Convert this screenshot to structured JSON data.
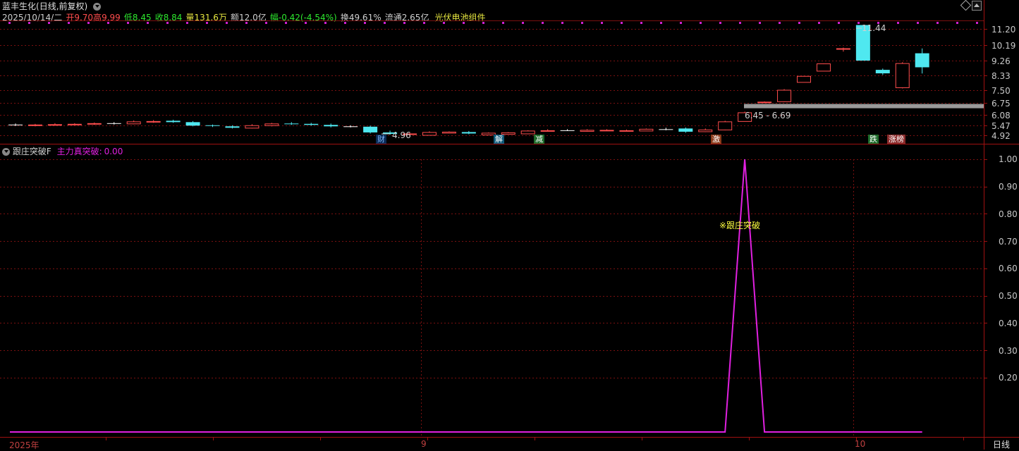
{
  "title_bar": {
    "stock_name": "蓝丰生化",
    "period": "(日线,前复权)",
    "menu_icon": "chevron-down-icon",
    "window_controls": [
      "pin-icon",
      "scroll-up-icon"
    ]
  },
  "quote": {
    "date": "2025/10/14/二",
    "open_label": "开",
    "open": "9.70",
    "high_label": "高",
    "high": "9.99",
    "low_label": "低",
    "low": "8.45",
    "close_label": "收",
    "close": "8.84",
    "volume_label": "量",
    "volume": "131.6万",
    "amount_label": "额",
    "amount": "12.0亿",
    "change_label": "幅",
    "change": "-0.42(-4.54%)",
    "turnover_label": "换",
    "turnover": "49.61%",
    "float_label": "流通",
    "float": "2.65亿",
    "sector": "光伏电池组件"
  },
  "price_axis": [
    "11.20",
    "10.19",
    "9.26",
    "8.33",
    "7.50",
    "6.75",
    "6.08",
    "5.47",
    "4.92"
  ],
  "indicator_axis": [
    "1.00",
    "0.90",
    "0.80",
    "0.70",
    "0.60",
    "0.50",
    "0.40",
    "0.30",
    "0.20"
  ],
  "annotations": {
    "high_label": "11.44",
    "low_label": "4.96",
    "range_label": "6.45 - 6.69",
    "signal_text": "※跟庄突破"
  },
  "event_markers": [
    {
      "label": "财",
      "color": "#3a8ee6",
      "bg": "#0a2a55"
    },
    {
      "label": "解",
      "color": "#ffffff",
      "bg": "#0f5a7a"
    },
    {
      "label": "减",
      "color": "#ffffff",
      "bg": "#1d6b2a"
    },
    {
      "label": "激",
      "color": "#ffffff",
      "bg": "#8a3a1a"
    },
    {
      "label": "跌",
      "color": "#ffffff",
      "bg": "#1d6b2a"
    },
    {
      "label": "涨榜",
      "color": "#ffffff",
      "bg": "#8a2a2a"
    }
  ],
  "indicator": {
    "name": "跟庄突破F",
    "line_label": "主力真突破:",
    "line_value": "0.00",
    "color": "#e020e0"
  },
  "time_axis": {
    "labels": [
      "2025年",
      "9",
      "10"
    ],
    "period_button": "日线"
  },
  "colors": {
    "up": "#ff4d4d",
    "down": "#4fe8f0",
    "grid": "#7a1010",
    "indicator_line": "#e020e0",
    "signal_text": "#ffff40",
    "highlight_band": "#9a9a9a"
  },
  "chart_data": {
    "type": "candlestick",
    "series": [
      {
        "ohlc": [
          [
            5.52,
            5.58,
            5.44,
            5.5
          ],
          [
            5.5,
            5.56,
            5.42,
            5.52
          ],
          [
            5.52,
            5.6,
            5.46,
            5.54
          ],
          [
            5.54,
            5.6,
            5.48,
            5.56
          ],
          [
            5.56,
            5.64,
            5.5,
            5.6
          ],
          [
            5.6,
            5.66,
            5.52,
            5.58
          ],
          [
            5.58,
            5.76,
            5.54,
            5.7
          ],
          [
            5.7,
            5.78,
            5.62,
            5.72
          ],
          [
            5.74,
            5.8,
            5.62,
            5.66
          ],
          [
            5.66,
            5.72,
            5.42,
            5.46
          ],
          [
            5.48,
            5.52,
            5.38,
            5.44
          ],
          [
            5.42,
            5.48,
            5.3,
            5.34
          ],
          [
            5.34,
            5.54,
            5.3,
            5.48
          ],
          [
            5.48,
            5.62,
            5.42,
            5.58
          ],
          [
            5.58,
            5.66,
            5.5,
            5.54
          ],
          [
            5.56,
            5.62,
            5.46,
            5.5
          ],
          [
            5.5,
            5.58,
            5.36,
            5.42
          ],
          [
            5.42,
            5.48,
            5.36,
            5.4
          ],
          [
            5.4,
            5.46,
            5.02,
            5.08
          ],
          [
            5.08,
            5.18,
            4.96,
            5.0
          ],
          [
            5.02,
            5.08,
            4.98,
            5.02
          ],
          [
            4.94,
            5.14,
            4.92,
            5.1
          ],
          [
            5.06,
            5.14,
            5.02,
            5.12
          ],
          [
            5.1,
            5.16,
            4.98,
            5.02
          ],
          [
            4.96,
            5.08,
            4.92,
            5.06
          ],
          [
            5.0,
            5.1,
            4.98,
            5.08
          ],
          [
            5.02,
            5.2,
            5.0,
            5.18
          ],
          [
            5.18,
            5.26,
            5.14,
            5.2
          ],
          [
            5.2,
            5.26,
            5.16,
            5.18
          ],
          [
            5.16,
            5.26,
            5.12,
            5.22
          ],
          [
            5.2,
            5.26,
            5.16,
            5.22
          ],
          [
            5.2,
            5.24,
            5.16,
            5.2
          ],
          [
            5.18,
            5.3,
            5.16,
            5.28
          ],
          [
            5.26,
            5.34,
            5.2,
            5.24
          ],
          [
            5.3,
            5.36,
            5.06,
            5.12
          ],
          [
            5.14,
            5.3,
            5.1,
            5.24
          ],
          [
            5.24,
            5.74,
            5.2,
            5.7
          ],
          [
            5.72,
            6.26,
            5.7,
            6.22
          ],
          [
            6.8,
            6.84,
            6.78,
            6.82
          ],
          [
            6.84,
            7.56,
            6.8,
            7.52
          ],
          [
            7.96,
            8.3,
            7.96,
            8.3
          ],
          [
            8.62,
            9.08,
            8.6,
            9.08
          ],
          [
            9.96,
            10.04,
            9.8,
            10.0
          ],
          [
            11.44,
            11.44,
            9.26,
            9.26
          ],
          [
            8.68,
            8.76,
            8.36,
            8.46
          ],
          [
            7.66,
            9.16,
            7.6,
            9.1
          ],
          [
            9.7,
            9.99,
            8.45,
            8.84
          ]
        ]
      }
    ],
    "indicator_series": {
      "name": "主力真突破",
      "values": [
        0,
        0,
        0,
        0,
        0,
        0,
        0,
        0,
        0,
        0,
        0,
        0,
        0,
        0,
        0,
        0,
        0,
        0,
        0,
        0,
        0,
        0,
        0,
        0,
        0,
        0,
        0,
        0,
        0,
        0,
        0,
        0,
        0,
        0,
        0,
        0,
        0,
        1,
        0,
        0,
        0,
        0,
        0,
        0,
        0,
        0,
        0
      ]
    },
    "x_labels": [
      "2025年",
      "9",
      "10"
    ],
    "ylim": [
      4.92,
      11.44
    ],
    "indicator_ylim": [
      0,
      1.0
    ]
  }
}
